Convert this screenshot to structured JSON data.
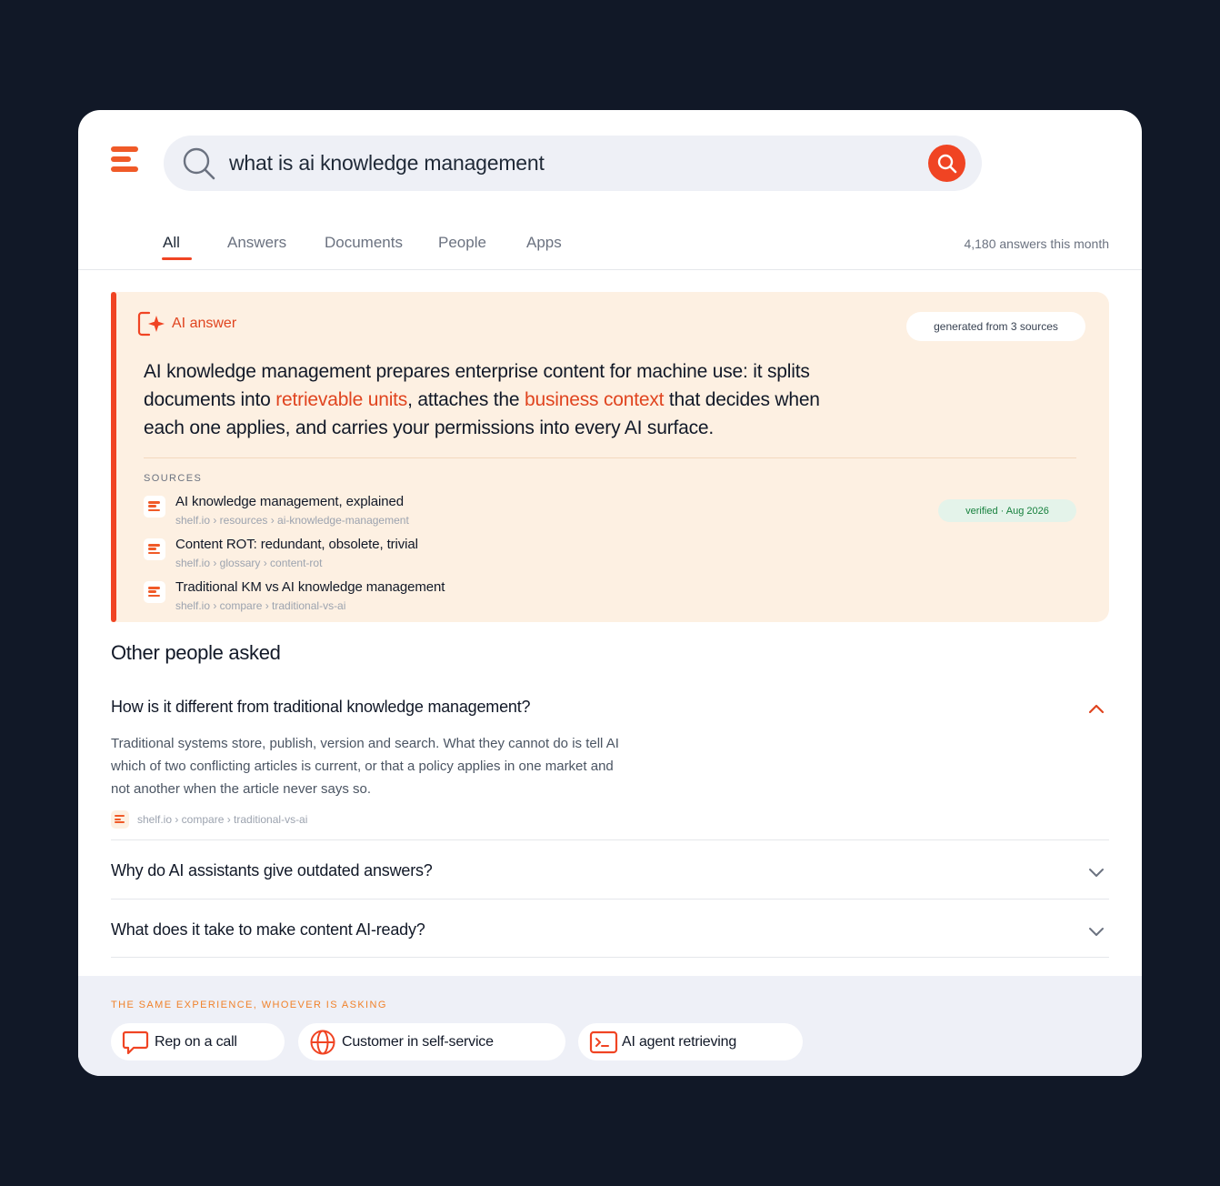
{
  "search": {
    "query": "what is ai knowledge management"
  },
  "tabs": {
    "items": [
      {
        "label": "All",
        "active": true
      },
      {
        "label": "Answers",
        "active": false
      },
      {
        "label": "Documents",
        "active": false
      },
      {
        "label": "People",
        "active": false
      },
      {
        "label": "Apps",
        "active": false
      }
    ],
    "count_text": "4,180 answers this month"
  },
  "ai_answer": {
    "label": "AI answer",
    "generated_from": "generated from 3 sources",
    "text_parts": [
      "AI knowledge management prepares enterprise content for machine use: it splits documents into ",
      "retrievable units",
      ", attaches the ",
      "business context",
      " that decides when each one applies, and carries your permissions into every AI surface."
    ],
    "sources_heading": "SOURCES",
    "verified": "verified · Aug 2026",
    "sources": [
      {
        "title": "AI knowledge management, explained",
        "url": "shelf.io › resources › ai-knowledge-management"
      },
      {
        "title": "Content ROT: redundant, obsolete, trivial",
        "url": "shelf.io › glossary › content-rot"
      },
      {
        "title": "Traditional KM vs AI knowledge management",
        "url": "shelf.io › compare › traditional-vs-ai"
      }
    ]
  },
  "other_asked": {
    "title": "Other people asked",
    "items": [
      {
        "question": "How is it different from traditional knowledge management?",
        "expanded": true,
        "answer": "Traditional systems store, publish, version and search. What they cannot do is tell AI which of two conflicting articles is current, or that a policy applies in one market and not another when the article never says so.",
        "source": "shelf.io › compare › traditional-vs-ai"
      },
      {
        "question": "Why do AI assistants give outdated answers?",
        "expanded": false
      },
      {
        "question": "What does it take to make content AI-ready?",
        "expanded": false
      }
    ]
  },
  "footer": {
    "heading": "THE SAME EXPERIENCE, WHOEVER IS ASKING",
    "chips": [
      {
        "label": "Rep on a call",
        "icon": "chat-bubble-icon"
      },
      {
        "label": "Customer in self-service",
        "icon": "globe-icon"
      },
      {
        "label": "AI agent retrieving",
        "icon": "terminal-icon"
      }
    ]
  },
  "colors": {
    "accent": "#f04423",
    "answer_bg": "#fdf0e2",
    "page_bg": "#111827"
  }
}
